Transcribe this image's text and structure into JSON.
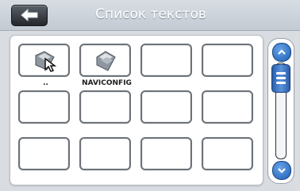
{
  "header": {
    "title": "Список текстов"
  },
  "colors": {
    "accent": "#2b5fab",
    "header": "#c8ced6",
    "panel": "#ffffff"
  },
  "grid": {
    "cells": [
      {
        "label": "..",
        "icon": "parent-folder-arrow-icon"
      },
      {
        "label": "NAVICONFIG",
        "icon": "folder-icon"
      },
      {
        "label": "",
        "icon": ""
      },
      {
        "label": "",
        "icon": ""
      },
      {
        "label": "",
        "icon": ""
      },
      {
        "label": "",
        "icon": ""
      },
      {
        "label": "",
        "icon": ""
      },
      {
        "label": "",
        "icon": ""
      },
      {
        "label": "",
        "icon": ""
      },
      {
        "label": "",
        "icon": ""
      },
      {
        "label": "",
        "icon": ""
      },
      {
        "label": "",
        "icon": ""
      }
    ]
  },
  "scrollbar": {
    "up_icon": "chevron-up-icon",
    "down_icon": "chevron-down-icon",
    "thumb_icon": "grip-icon"
  }
}
